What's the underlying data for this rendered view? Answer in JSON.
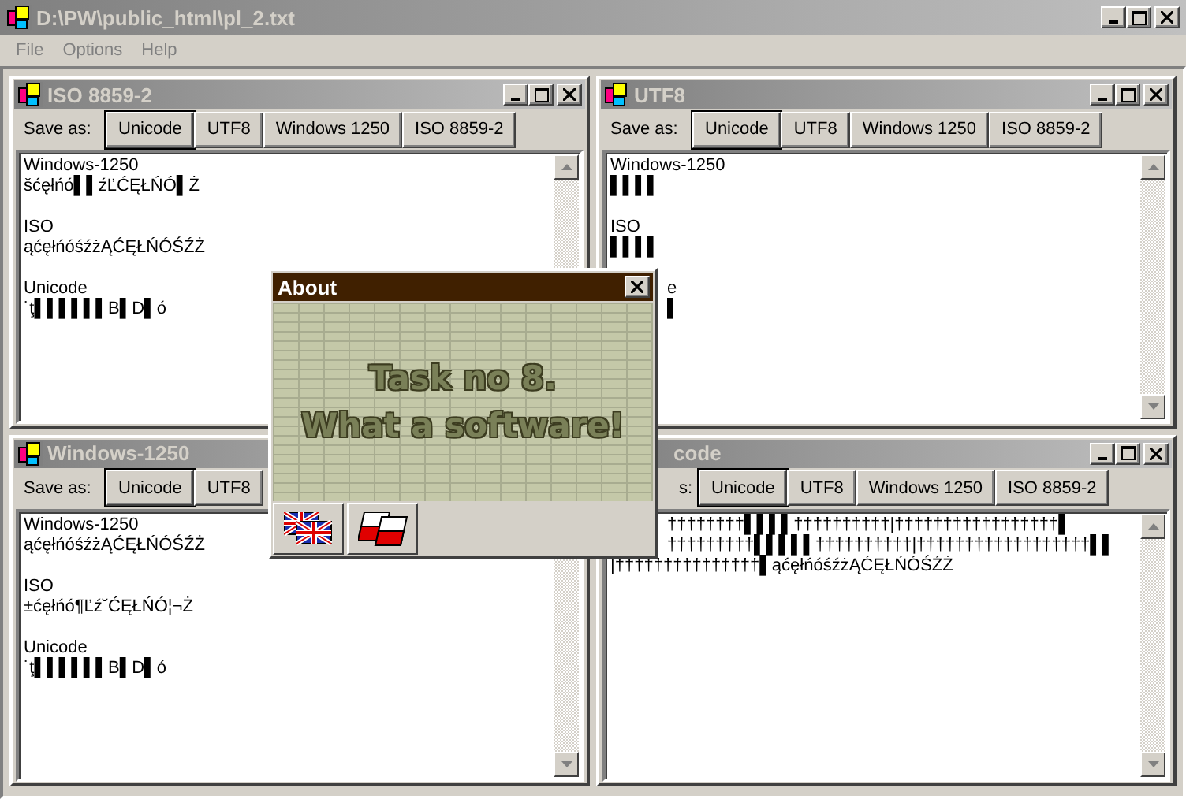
{
  "window": {
    "title": "D:\\PW\\public_html\\pl_2.txt"
  },
  "menu": [
    {
      "label": "File",
      "disabled": true
    },
    {
      "label": "Options",
      "disabled": true
    },
    {
      "label": "Help",
      "disabled": true
    }
  ],
  "documents": [
    {
      "title": "ISO 8859-2",
      "behind_dialog": false,
      "save_label": {
        "text": "Save as:",
        "behind_dialog": false
      },
      "buttons": [
        {
          "label": "Unicode",
          "default": true
        },
        {
          "label": "UTF8",
          "default": false
        },
        {
          "label": "Windows 1250",
          "default": false
        },
        {
          "label": "ISO 8859-2",
          "default": false
        }
      ],
      "paragraphs": [
        [
          {
            "text": "Windows-1250",
            "behind_dialog": false
          },
          {
            "text": "šćęłńó▌▌źĽĆĘŁŃÓ▌Ż",
            "behind_dialog": false
          }
        ],
        [
          {
            "text": "ISO",
            "behind_dialog": false
          },
          {
            "text": "ąćęłńóśźżĄĆĘŁŃÓŚŹŻ",
            "behind_dialog": false
          }
        ],
        [
          {
            "text": "Unicode",
            "behind_dialog": false
          },
          {
            "text": "˙ţ▌▌▌▌▌▌B▌D▌ó",
            "behind_dialog": false
          }
        ]
      ]
    },
    {
      "title": "UTF8",
      "behind_dialog": false,
      "save_label": {
        "text": "Save as:",
        "behind_dialog": false
      },
      "buttons": [
        {
          "label": "Unicode",
          "default": true
        },
        {
          "label": "UTF8",
          "default": false
        },
        {
          "label": "Windows 1250",
          "default": false
        },
        {
          "label": "ISO 8859-2",
          "default": false
        }
      ],
      "paragraphs": [
        [
          {
            "text": "Windows-1250",
            "behind_dialog": false
          },
          {
            "text": "▌▌▌▌",
            "behind_dialog": false
          }
        ],
        [
          {
            "text": "ISO",
            "behind_dialog": false
          },
          {
            "text": "▌▌▌▌",
            "behind_dialog": false
          }
        ],
        [
          {
            "text": "e",
            "behind_dialog": true
          },
          {
            "text": "▌",
            "behind_dialog": true
          }
        ]
      ]
    },
    {
      "title": "Windows-1250",
      "behind_dialog": false,
      "save_label": {
        "text": "Save as:",
        "behind_dialog": false
      },
      "buttons": [
        {
          "label": "Unicode",
          "default": true
        },
        {
          "label": "UTF8",
          "default": false
        }
      ],
      "paragraphs": [
        [
          {
            "text": "Windows-1250",
            "behind_dialog": false
          },
          {
            "text": "ąćęłńóśźżĄĆĘŁŃÓŚŹŻ",
            "behind_dialog": false
          }
        ],
        [
          {
            "text": "ISO",
            "behind_dialog": false
          },
          {
            "text": "±ćęłńó¶Ľź˘ĆĘŁŃÓ¦¬Ż",
            "behind_dialog": false
          }
        ],
        [
          {
            "text": "Unicode",
            "behind_dialog": false
          },
          {
            "text": "˙ţ▌▌▌▌▌▌B▌D▌ó",
            "behind_dialog": false
          }
        ]
      ]
    },
    {
      "title": "code",
      "behind_dialog": true,
      "save_label": {
        "text": "s:",
        "behind_dialog": true
      },
      "buttons": [
        {
          "label": "Unicode",
          "default": true
        },
        {
          "label": "UTF8",
          "default": false
        },
        {
          "label": "Windows 1250",
          "default": false
        },
        {
          "label": "ISO 8859-2",
          "default": false
        }
      ],
      "paragraphs": [
        [
          {
            "text": "††††††††▌▌▌▌††††††††††|†††††††††††††††††▌",
            "behind_dialog": true
          },
          {
            "text": "†††††††††▌▌▌▌▌††††††††††|††††††††††††††††††▌▌",
            "behind_dialog": true
          },
          {
            "text": "|†††††††††††††††▌ąćęłńóśźżĄĆĘŁŃÓŚŹŻ",
            "behind_dialog": false
          }
        ]
      ]
    }
  ],
  "dialog": {
    "title": "About",
    "lines": [
      "Task no 8.",
      "What a software!"
    ],
    "buttons": [
      {
        "kind": "uk_flag"
      },
      {
        "kind": "pl_flag"
      }
    ]
  }
}
